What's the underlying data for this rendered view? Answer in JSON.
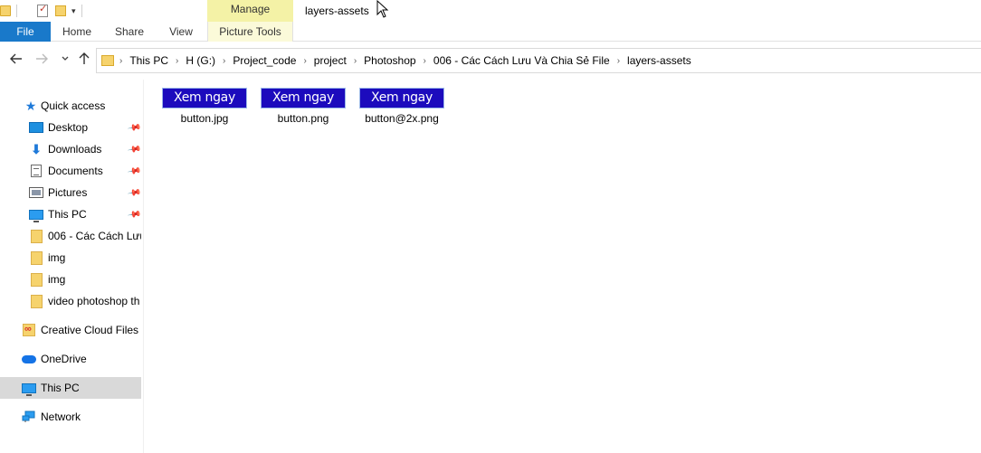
{
  "window": {
    "manage_tab": "Manage",
    "title": "layers-assets"
  },
  "ribbon": {
    "tabs": [
      {
        "label": "File"
      },
      {
        "label": "Home"
      },
      {
        "label": "Share"
      },
      {
        "label": "View"
      },
      {
        "label": "Picture Tools"
      }
    ]
  },
  "navigation": {
    "back_icon": "arrow-left-icon",
    "forward_icon": "arrow-right-icon",
    "recent_icon": "chevron-down-icon",
    "up_icon": "arrow-up-icon"
  },
  "address_bar": {
    "crumbs": [
      "This PC",
      "H (G:)",
      "Project_code",
      "project",
      "Photoshop",
      "006 - Các Cách Lưu Và Chia Sẻ File",
      "layers-assets"
    ]
  },
  "sidebar": {
    "items": [
      {
        "label": "Quick access",
        "icon": "star-icon",
        "pinned": false
      },
      {
        "label": "Desktop",
        "icon": "desktop-icon",
        "pinned": true
      },
      {
        "label": "Downloads",
        "icon": "download-icon",
        "pinned": true
      },
      {
        "label": "Documents",
        "icon": "documents-icon",
        "pinned": true
      },
      {
        "label": "Pictures",
        "icon": "pictures-icon",
        "pinned": true
      },
      {
        "label": "This PC",
        "icon": "computer-icon",
        "pinned": true
      },
      {
        "label": "006 - Các Cách Lưu",
        "icon": "folder-icon",
        "pinned": false
      },
      {
        "label": "img",
        "icon": "folder-icon",
        "pinned": false
      },
      {
        "label": "img",
        "icon": "folder-icon",
        "pinned": false
      },
      {
        "label": "video photoshop th",
        "icon": "folder-icon",
        "pinned": false
      },
      {
        "label": "Creative Cloud Files",
        "icon": "creative-cloud-icon",
        "pinned": false
      },
      {
        "label": "OneDrive",
        "icon": "cloud-icon",
        "pinned": false
      },
      {
        "label": "This PC",
        "icon": "computer-icon",
        "pinned": false,
        "selected": true
      },
      {
        "label": "Network",
        "icon": "network-icon",
        "pinned": false
      }
    ]
  },
  "files": [
    {
      "name": "button.jpg",
      "thumbnail_text": "Xem ngay"
    },
    {
      "name": "button.png",
      "thumbnail_text": "Xem ngay"
    },
    {
      "name": "button@2x.png",
      "thumbnail_text": "Xem ngay"
    }
  ],
  "colors": {
    "file_tab": "#1979ca",
    "manage_tab": "#f4f2a6",
    "thumbnail_bg": "#1c0bbd",
    "selected_item": "#d9d9d9"
  }
}
